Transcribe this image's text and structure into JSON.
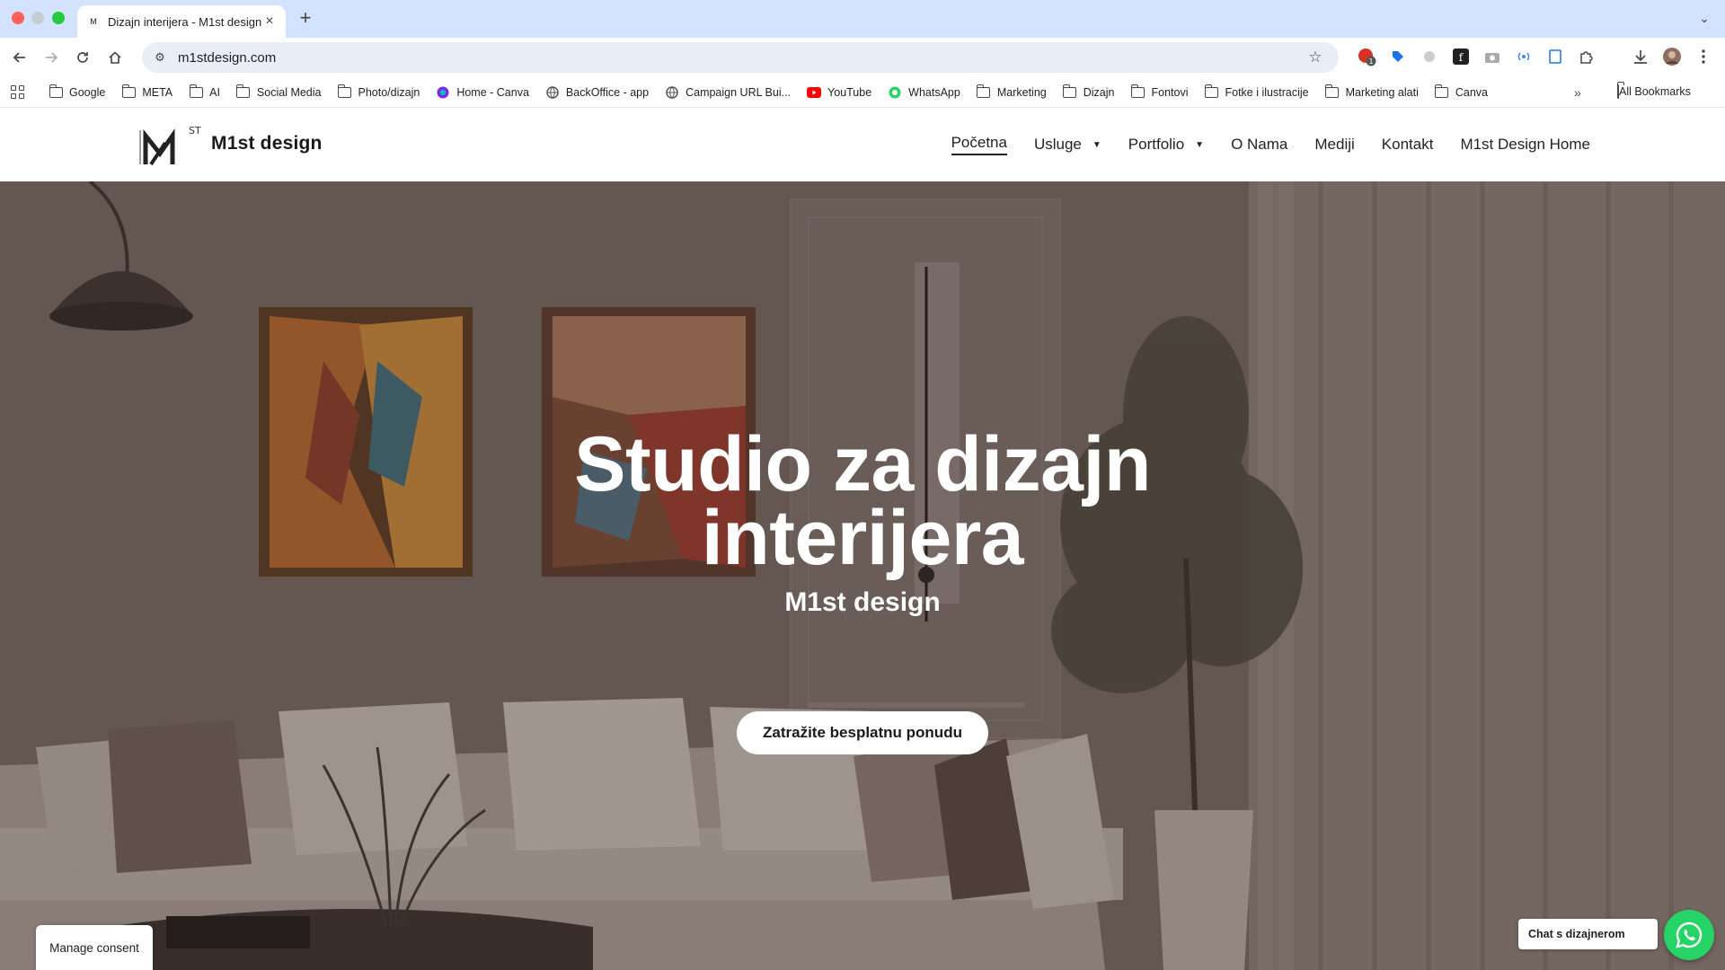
{
  "browser": {
    "tab_title": "Dizajn interijera - M1st design",
    "tab_favicon": "M",
    "url": "m1stdesign.com",
    "bookmarks": [
      {
        "label": "Google",
        "icon": "folder-icon"
      },
      {
        "label": "META",
        "icon": "folder-icon"
      },
      {
        "label": "AI",
        "icon": "folder-icon"
      },
      {
        "label": "Social Media",
        "icon": "folder-icon"
      },
      {
        "label": "Photo/dizajn",
        "icon": "folder-icon"
      },
      {
        "label": "Home - Canva",
        "icon": "canva-icon"
      },
      {
        "label": "BackOffice - app",
        "icon": "globe-icon"
      },
      {
        "label": "Campaign URL Bui...",
        "icon": "globe-icon"
      },
      {
        "label": "YouTube",
        "icon": "youtube-icon"
      },
      {
        "label": "WhatsApp",
        "icon": "whatsapp-icon"
      },
      {
        "label": "Marketing",
        "icon": "folder-icon"
      },
      {
        "label": "Dizajn",
        "icon": "folder-icon"
      },
      {
        "label": "Fontovi",
        "icon": "folder-icon"
      },
      {
        "label": "Fotke i ilustracije",
        "icon": "folder-icon"
      },
      {
        "label": "Marketing alati",
        "icon": "folder-icon"
      },
      {
        "label": "Canva",
        "icon": "folder-icon"
      }
    ],
    "all_bookmarks": "All Bookmarks",
    "extension_badge": "1"
  },
  "site": {
    "logo_sup": "ST",
    "brand": "M1st design",
    "nav": [
      {
        "label": "Početna",
        "active": true,
        "dropdown": false
      },
      {
        "label": "Usluge",
        "active": false,
        "dropdown": true
      },
      {
        "label": "Portfolio",
        "active": false,
        "dropdown": true
      },
      {
        "label": "O Nama",
        "active": false,
        "dropdown": false
      },
      {
        "label": "Mediji",
        "active": false,
        "dropdown": false
      },
      {
        "label": "Kontakt",
        "active": false,
        "dropdown": false
      },
      {
        "label": "M1st Design Home",
        "active": false,
        "dropdown": false
      }
    ]
  },
  "hero": {
    "title_line1": "Studio za dizajn",
    "title_line2": "interijera",
    "subtitle": "M1st design",
    "cta": "Zatražite besplatnu ponudu"
  },
  "consent": "Manage consent",
  "chat": {
    "label": "Chat s dizajnerom",
    "icon": "whatsapp-icon",
    "color": "#25d366"
  }
}
